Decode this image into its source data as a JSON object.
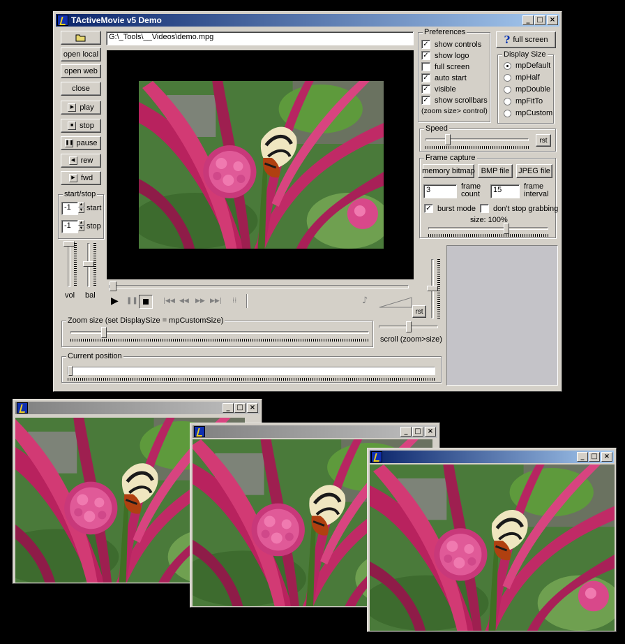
{
  "main_window": {
    "title": "TActiveMovie v5 Demo",
    "file_path": "G:\\_Tools\\__Videos\\demo.mpg",
    "buttons": {
      "open_local": "open local",
      "open_web": "open web",
      "close": "close",
      "play": "play",
      "stop": "stop",
      "pause": "pause",
      "rew": "rew",
      "fwd": "fwd",
      "full_screen": "full screen"
    },
    "start_stop": {
      "caption": "start/stop",
      "start_value": "-1",
      "start_label": "start",
      "stop_value": "-1",
      "stop_label": "stop"
    },
    "vol_label": "vol",
    "bal_label": "bal",
    "preferences": {
      "caption": "Preferences",
      "items": [
        {
          "label": "show controls",
          "checked": true
        },
        {
          "label": "show logo",
          "checked": true
        },
        {
          "label": "full screen",
          "checked": false
        },
        {
          "label": "auto start",
          "checked": true
        },
        {
          "label": "visible",
          "checked": true
        },
        {
          "label": "show scrollbars",
          "checked": true
        }
      ],
      "note": "(zoom size> control)"
    },
    "display_size": {
      "caption": "Display Size",
      "options": [
        "mpDefault",
        "mpHalf",
        "mpDouble",
        "mpFitTo",
        "mpCustom"
      ],
      "selected": "mpDefault"
    },
    "speed": {
      "caption": "Speed",
      "rst": "rst"
    },
    "frame_capture": {
      "caption": "Frame capture",
      "memory_bitmap": "memory bitmap",
      "bmp_file": "BMP file",
      "jpeg_file": "JPEG file",
      "frame_count_value": "3",
      "frame_count_label": "frame count",
      "frame_interval_value": "15",
      "frame_interval_label": "frame interval",
      "burst_mode": "burst mode",
      "burst_mode_checked": true,
      "dont_stop": "don't stop grabbing",
      "dont_stop_checked": false,
      "size_label": "size: 100%",
      "size_percent": 100
    },
    "zoom": {
      "caption": "Zoom size  (set DisplaySize = mpCustomSize)"
    },
    "scroll_label": "scroll (zoom>size)",
    "rst2": "rst",
    "current_position": {
      "caption": "Current position"
    }
  },
  "capture_windows": [
    {
      "name": "capture-window-1"
    },
    {
      "name": "capture-window-2"
    },
    {
      "name": "capture-window-3"
    }
  ],
  "colors": {
    "face": "#d4d0c8",
    "title_active": "#0a246a",
    "title_inactive": "#808080"
  }
}
